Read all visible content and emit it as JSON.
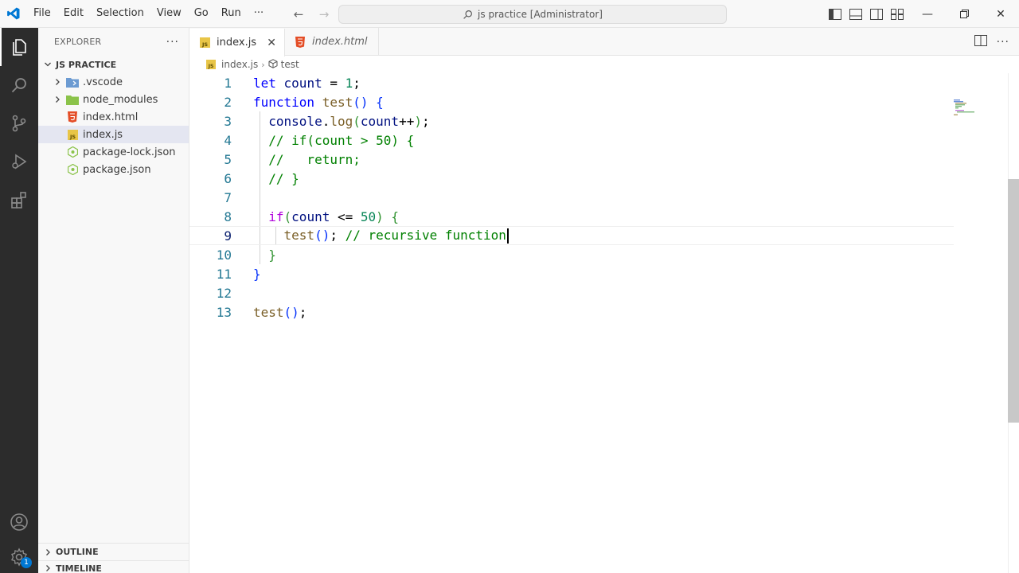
{
  "titlebar": {
    "menu": [
      "File",
      "Edit",
      "Selection",
      "View",
      "Go",
      "Run",
      "···"
    ],
    "command_center": "js practice [Administrator]"
  },
  "sidebar": {
    "header": "EXPLORER",
    "more": "···",
    "project": "JS PRACTICE",
    "folders": [
      ".vscode",
      "node_modules"
    ],
    "files": [
      "index.html",
      "index.js",
      "package-lock.json",
      "package.json"
    ],
    "outline": "OUTLINE",
    "timeline": "TIMELINE"
  },
  "tabs": [
    {
      "label": "index.js"
    },
    {
      "label": "index.html"
    }
  ],
  "breadcrumbs": {
    "file": "index.js",
    "symbol": "test"
  },
  "editor": {
    "line_numbers": [
      "1",
      "2",
      "3",
      "4",
      "5",
      "6",
      "7",
      "8",
      "9",
      "10",
      "11",
      "12",
      "13"
    ],
    "current_line": 9
  },
  "activity": {
    "badge": "1"
  },
  "colors": {
    "activity_bar": "#2c2c2c",
    "sidebar": "#f8f8f8",
    "selection": "#e4e6f1",
    "keyword": "#0000ff",
    "control": "#af00db",
    "function": "#795e26",
    "number": "#098658",
    "comment": "#008000",
    "variable": "#001080",
    "line_number": "#237893"
  }
}
